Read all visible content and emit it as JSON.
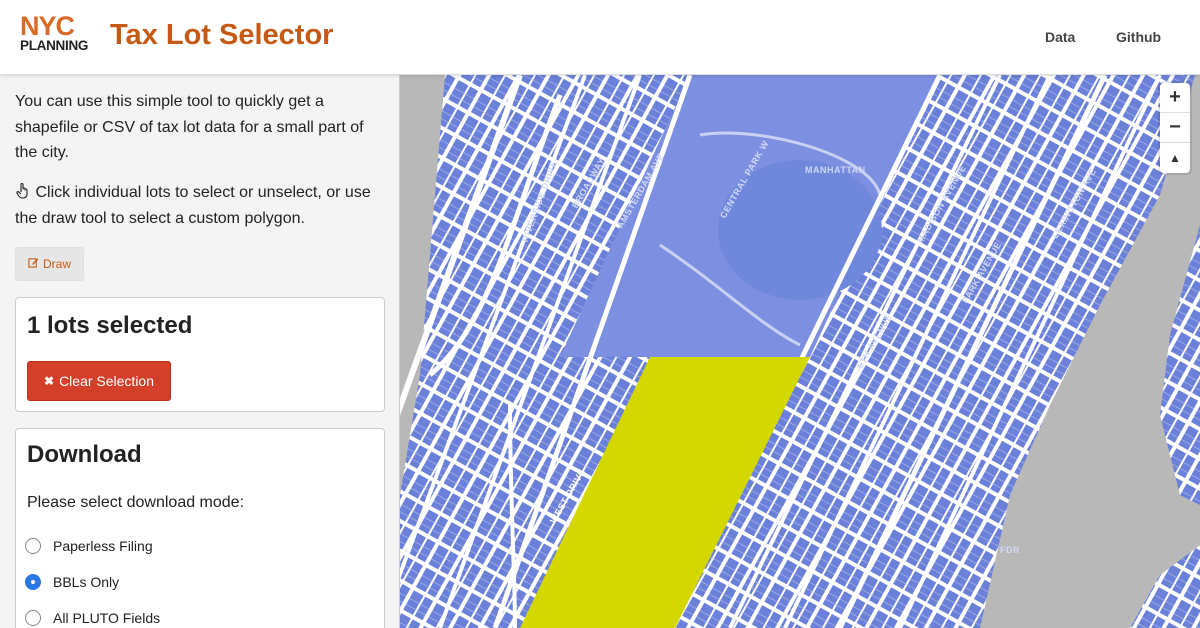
{
  "header": {
    "logo_top": "NYC",
    "logo_bottom": "PLANNING",
    "title": "Tax Lot Selector",
    "nav": [
      {
        "label": "Data"
      },
      {
        "label": "Github"
      }
    ]
  },
  "sidebar": {
    "intro": "You can use this simple tool to quickly get a shapefile or CSV of tax lot data for a small part of the city.",
    "hint": "Click individual lots to select or unselect, or use the draw tool to select a custom polygon.",
    "draw_button": "Draw",
    "selection": {
      "count_text": "1 lots selected",
      "clear_button": "Clear Selection"
    },
    "download": {
      "heading": "Download",
      "prompt": "Please select download mode:",
      "options": [
        {
          "label": "Paperless Filing",
          "checked": false
        },
        {
          "label": "BBLs Only",
          "checked": true
        },
        {
          "label": "All PLUTO Fields",
          "checked": false
        }
      ]
    }
  },
  "map": {
    "zoom_in": "+",
    "zoom_out": "−",
    "reset_bearing": "▲",
    "labels": {
      "manhattan": "MANHATTAN",
      "fdr": "FDR",
      "west_drive": "WEST DRIVE",
      "central_park_w": "CENTRAL PARK W",
      "madison": "MADISON AVENUE",
      "park_ave": "PARK AVENUE",
      "riverside": "RIVERSIDE DRIVE",
      "amsterdam": "AMSTERDAM AVE",
      "broadway": "BROADWAY",
      "fifth": "5TH AVENUE",
      "lexington": "LEXINGTON AVE"
    },
    "colors": {
      "lots": "#6b80d8",
      "streets": "#ffffff",
      "water": "#b8b8b8",
      "park": "#7d8fe0",
      "selected": "#d5d700"
    }
  }
}
